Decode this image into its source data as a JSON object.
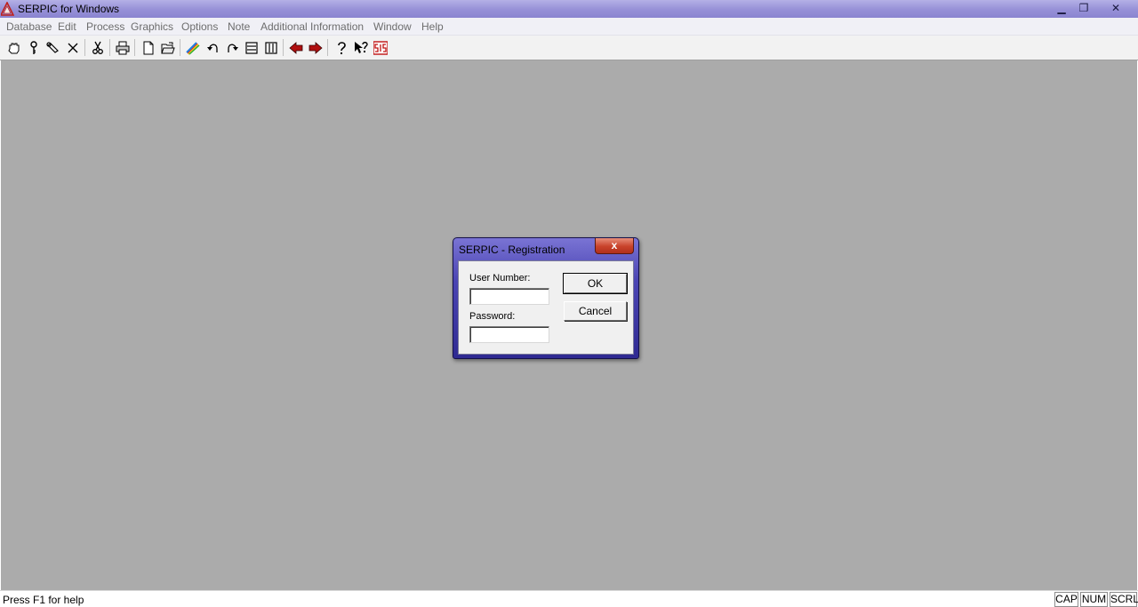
{
  "window": {
    "title": "SERPIC for Windows",
    "minimize_glyph": "▁",
    "restore_glyph": "❐",
    "close_glyph": "✕"
  },
  "menu": [
    {
      "label": "Database"
    },
    {
      "label": "Edit"
    },
    {
      "label": "Process"
    },
    {
      "label": "Graphics"
    },
    {
      "label": "Options"
    },
    {
      "label": "Note"
    },
    {
      "label": "Additional Information"
    },
    {
      "label": "Window"
    },
    {
      "label": "Help"
    }
  ],
  "toolbar": {
    "icons": [
      "hand-icon",
      "key-icon",
      "wrench-icon",
      "delete-icon",
      "cut-icon",
      "print-icon",
      "new-document-icon",
      "open-folder-icon",
      "rainbow-pen-icon",
      "undo-icon",
      "redo-icon",
      "horizontal-layout-icon",
      "vertical-layout-icon",
      "previous-arrow-icon",
      "next-arrow-icon",
      "help-icon",
      "context-help-icon",
      "sis-logo-icon"
    ]
  },
  "dialog": {
    "title": "SERPIC - Registration",
    "close_glyph": "x",
    "user_number_label": "User Number:",
    "user_number_value": "",
    "password_label": "Password:",
    "password_value": "",
    "ok_label": "OK",
    "cancel_label": "Cancel"
  },
  "status": {
    "help_text": "Press F1 for help",
    "indicators": [
      "CAP",
      "NUM",
      "SCRL"
    ]
  },
  "colors": {
    "workspace": "#ababab",
    "titlebar": "#9892d8",
    "dialog_frame": "#4b45b4",
    "close_button": "#c8422a"
  }
}
